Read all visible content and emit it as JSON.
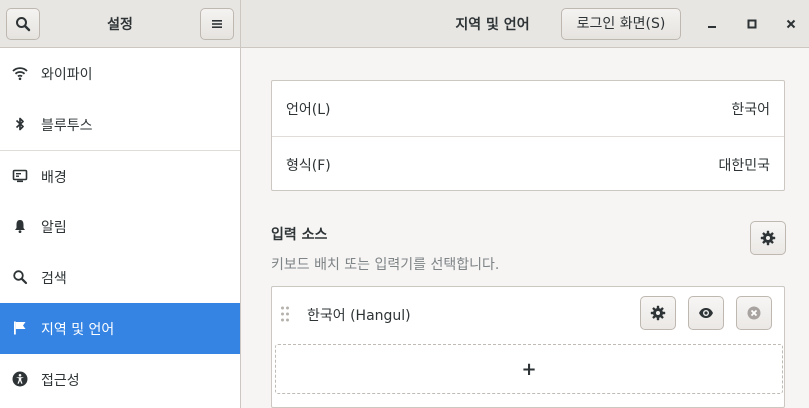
{
  "header": {
    "sidebar_title": "설정",
    "main_title": "지역 및 언어",
    "login_screen_label": "로그인 화면(S)"
  },
  "sidebar": {
    "items": [
      {
        "label": "와이파이",
        "icon": "wifi-icon"
      },
      {
        "label": "블루투스",
        "icon": "bluetooth-icon"
      },
      {
        "label": "배경",
        "icon": "background-icon"
      },
      {
        "label": "알림",
        "icon": "bell-icon"
      },
      {
        "label": "검색",
        "icon": "search-icon"
      },
      {
        "label": "지역 및 언어",
        "icon": "flag-icon",
        "active": true
      },
      {
        "label": "접근성",
        "icon": "accessibility-icon"
      }
    ]
  },
  "language": {
    "rows": [
      {
        "key": "언어(L)",
        "value": "한국어"
      },
      {
        "key": "형식(F)",
        "value": "대한민국"
      }
    ]
  },
  "input_sources": {
    "heading": "입력 소스",
    "description": "키보드 배치 또는 입력기를 선택합니다.",
    "items": [
      {
        "name": "한국어 (Hangul)"
      }
    ],
    "add_label": "+"
  },
  "colors": {
    "accent": "#3584e4",
    "headerbar": "#e8e6e3",
    "sidebar_bg": "#ffffff",
    "content_bg": "#f6f5f4"
  }
}
